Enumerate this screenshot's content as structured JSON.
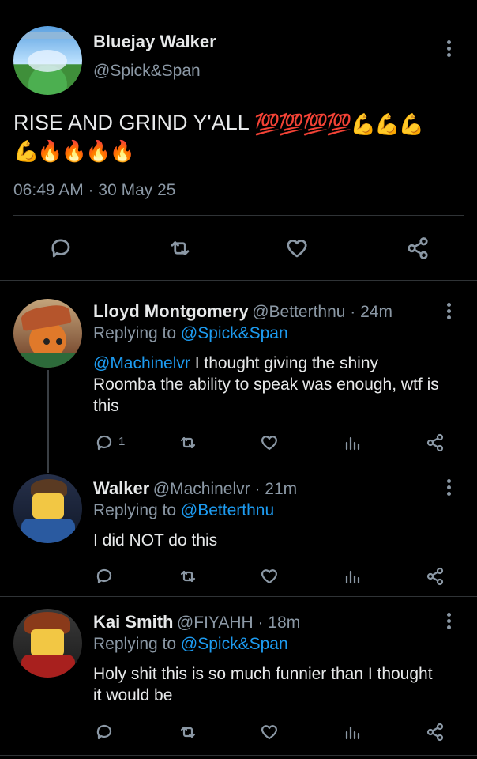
{
  "main_tweet": {
    "display_name": "Bluejay Walker",
    "handle": "@Spick&Span",
    "text": "RISE AND GRIND Y'ALL",
    "emojis_line1": "💯💯💯💯💪💪💪",
    "emojis_line2": "💪🔥🔥🔥🔥",
    "timestamp": "06:49 AM · 30 May 25"
  },
  "replies": [
    {
      "display_name": "Lloyd Montgomery",
      "handle": "@Betterthnu · 24m",
      "replying_label": "Replying to",
      "replying_to": "@Spick&Span",
      "mention": "@Machinelvr",
      "text": " I thought giving the shiny Roomba the ability to speak was enough, wtf is this",
      "reply_count": "1"
    },
    {
      "display_name": "Walker",
      "handle": "@Machinelvr · 21m",
      "replying_label": "Replying to",
      "replying_to": "@Betterthnu",
      "text": "I did NOT do this"
    },
    {
      "display_name": "Kai Smith",
      "handle": "@FIYAHH · 18m",
      "replying_label": "Replying to",
      "replying_to": "@Spick&Span",
      "text": "Holy shit this is so much funnier than I thought it would be"
    }
  ],
  "icons": [
    "reply-icon",
    "retweet-icon",
    "like-icon",
    "share-icon",
    "views-icon",
    "more-icon"
  ],
  "colors": {
    "background": "#000000",
    "text": "#e7e9ea",
    "muted": "#8b98a5",
    "link": "#1d9bf0",
    "divider": "#2f3336"
  }
}
